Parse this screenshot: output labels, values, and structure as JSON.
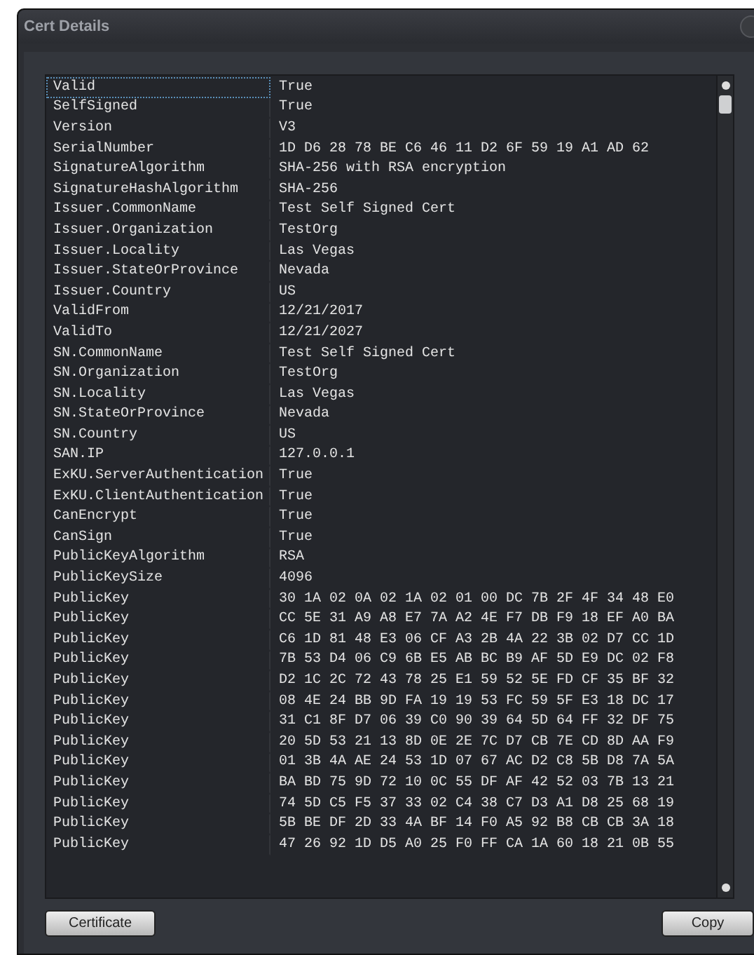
{
  "window": {
    "title": "Cert Details"
  },
  "table": {
    "rows": [
      {
        "key": "Valid",
        "value": "True",
        "selected": true
      },
      {
        "key": "SelfSigned",
        "value": "True",
        "selected": false
      },
      {
        "key": "Version",
        "value": "V3",
        "selected": false
      },
      {
        "key": "SerialNumber",
        "value": "1D D6 28 78 BE C6 46 11 D2 6F 59 19 A1 AD 62",
        "selected": false
      },
      {
        "key": "SignatureAlgorithm",
        "value": "SHA-256 with RSA encryption",
        "selected": false
      },
      {
        "key": "SignatureHashAlgorithm",
        "value": "SHA-256",
        "selected": false
      },
      {
        "key": "Issuer.CommonName",
        "value": "Test Self Signed Cert",
        "selected": false
      },
      {
        "key": "Issuer.Organization",
        "value": "TestOrg",
        "selected": false
      },
      {
        "key": "Issuer.Locality",
        "value": "Las Vegas",
        "selected": false
      },
      {
        "key": "Issuer.StateOrProvince",
        "value": "Nevada",
        "selected": false
      },
      {
        "key": "Issuer.Country",
        "value": "US",
        "selected": false
      },
      {
        "key": "ValidFrom",
        "value": "12/21/2017",
        "selected": false
      },
      {
        "key": "ValidTo",
        "value": "12/21/2027",
        "selected": false
      },
      {
        "key": "SN.CommonName",
        "value": "Test Self Signed Cert",
        "selected": false
      },
      {
        "key": "SN.Organization",
        "value": "TestOrg",
        "selected": false
      },
      {
        "key": "SN.Locality",
        "value": "Las Vegas",
        "selected": false
      },
      {
        "key": "SN.StateOrProvince",
        "value": "Nevada",
        "selected": false
      },
      {
        "key": "SN.Country",
        "value": "US",
        "selected": false
      },
      {
        "key": "SAN.IP",
        "value": "127.0.0.1",
        "selected": false
      },
      {
        "key": "ExKU.ServerAuthentication",
        "value": "True",
        "selected": false
      },
      {
        "key": "ExKU.ClientAuthentication",
        "value": "True",
        "selected": false
      },
      {
        "key": "CanEncrypt",
        "value": "True",
        "selected": false
      },
      {
        "key": "CanSign",
        "value": "True",
        "selected": false
      },
      {
        "key": "PublicKeyAlgorithm",
        "value": "RSA",
        "selected": false
      },
      {
        "key": "PublicKeySize",
        "value": "4096",
        "selected": false
      },
      {
        "key": "PublicKey",
        "value": "30 1A 02 0A 02 1A 02 01 00 DC 7B 2F 4F 34 48 E0",
        "selected": false
      },
      {
        "key": "PublicKey",
        "value": "CC 5E 31 A9 A8 E7 7A A2 4E F7 DB F9 18 EF A0 BA",
        "selected": false
      },
      {
        "key": "PublicKey",
        "value": "C6 1D 81 48 E3 06 CF A3 2B 4A 22 3B 02 D7 CC 1D",
        "selected": false
      },
      {
        "key": "PublicKey",
        "value": "7B 53 D4 06 C9 6B E5 AB BC B9 AF 5D E9 DC 02 F8",
        "selected": false
      },
      {
        "key": "PublicKey",
        "value": "D2 1C 2C 72 43 78 25 E1 59 52 5E FD CF 35 BF 32",
        "selected": false
      },
      {
        "key": "PublicKey",
        "value": "08 4E 24 BB 9D FA 19 19 53 FC 59 5F E3 18 DC 17",
        "selected": false
      },
      {
        "key": "PublicKey",
        "value": "31 C1 8F D7 06 39 C0 90 39 64 5D 64 FF 32 DF 75",
        "selected": false
      },
      {
        "key": "PublicKey",
        "value": "20 5D 53 21 13 8D 0E 2E 7C D7 CB 7E CD 8D AA F9",
        "selected": false
      },
      {
        "key": "PublicKey",
        "value": "01 3B 4A AE 24 53 1D 07 67 AC D2 C8 5B D8 7A 5A",
        "selected": false
      },
      {
        "key": "PublicKey",
        "value": "BA BD 75 9D 72 10 0C 55 DF AF 42 52 03 7B 13 21",
        "selected": false
      },
      {
        "key": "PublicKey",
        "value": "74 5D C5 F5 37 33 02 C4 38 C7 D3 A1 D8 25 68 19",
        "selected": false
      },
      {
        "key": "PublicKey",
        "value": "5B BE DF 2D 33 4A BF 14 F0 A5 92 B8 CB CB 3A 18",
        "selected": false
      },
      {
        "key": "PublicKey",
        "value": "47 26 92 1D D5 A0 25 F0 FF CA 1A 60 18 21 0B 55",
        "selected": false
      }
    ]
  },
  "buttons": [
    {
      "label": "Certificate"
    },
    {
      "label": "Copy"
    }
  ]
}
